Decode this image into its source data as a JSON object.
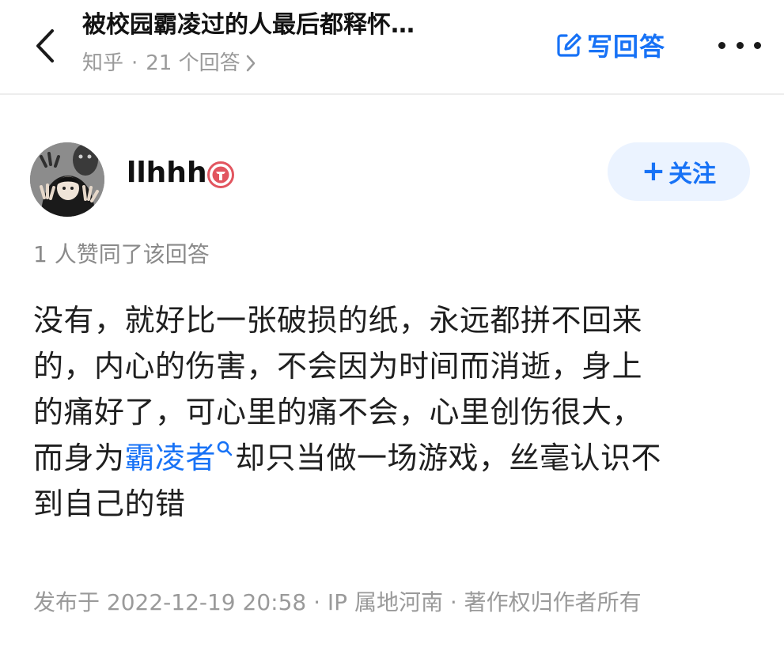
{
  "header": {
    "question_title": "被校园霸凌过的人最后都释怀…",
    "source": "知乎",
    "separator": "·",
    "answer_count": "21 个回答",
    "write_answer_label": "写回答"
  },
  "author": {
    "name": "llhhh",
    "follow_label": "关注",
    "follow_plus": "+"
  },
  "answer": {
    "votes_text": "1 人赞同了该回答",
    "line1": "没有，就好比一张破损的纸，永远都拼不回来",
    "line2": "的，内心的伤害，不会因为时间而消逝，身上",
    "line3": "的痛好了，可心里的痛不会，心里创伤很大，",
    "line4_pre": "而身为",
    "line4_link": "霸凌者",
    "line4_post": "却只当做一场游戏，丝毫认识不",
    "line5": "到自己的错",
    "footer": "发布于 2022-12-19 20:58 · IP 属地河南 · 著作权归作者所有"
  },
  "colors": {
    "accent": "#1772f6",
    "follow_bg": "#ebf3ff",
    "meta_gray": "#9a9a9a",
    "badge_red": "#e2555f"
  },
  "icons": {
    "back": "chevron-left-icon",
    "answers_chevron": "chevron-right-icon",
    "write": "edit-icon",
    "more": "more-dots-icon",
    "badge": "member-badge-icon",
    "search_link": "search-icon"
  }
}
